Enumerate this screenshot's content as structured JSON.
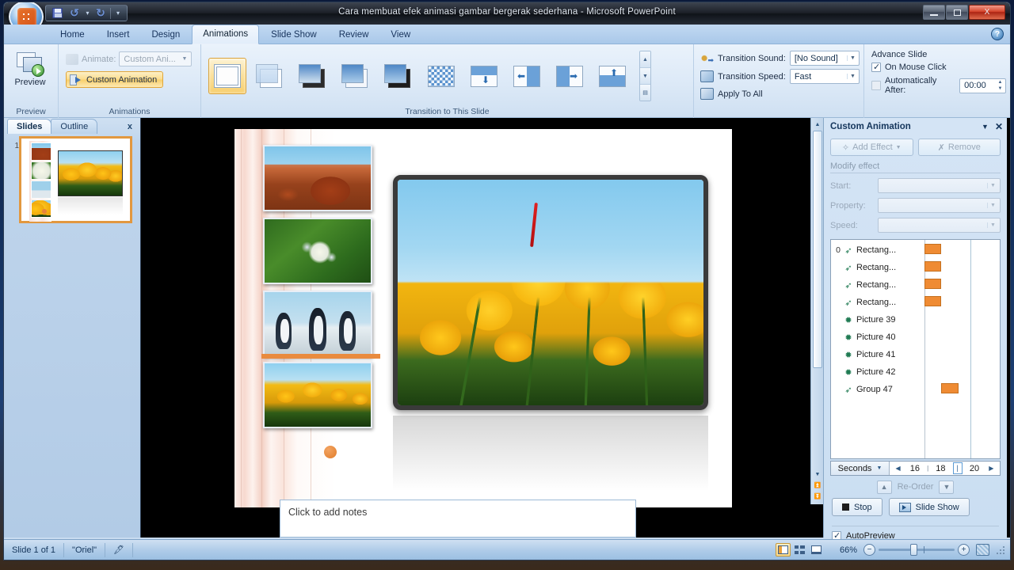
{
  "window": {
    "title": "Cara membuat efek animasi gambar bergerak sederhana  -  Microsoft PowerPoint",
    "minimize_label": "Minimize",
    "maximize_label": "Restore",
    "close_label": "X"
  },
  "quick_access": {
    "save": "save-icon",
    "undo": "undo-icon",
    "undo_dropdown": "chevron-down-icon",
    "redo": "redo-icon",
    "customize": "customize-icon"
  },
  "ribbon": {
    "tabs": [
      {
        "label": "Home",
        "active": false
      },
      {
        "label": "Insert",
        "active": false
      },
      {
        "label": "Design",
        "active": false
      },
      {
        "label": "Animations",
        "active": true
      },
      {
        "label": "Slide Show",
        "active": false
      },
      {
        "label": "Review",
        "active": false
      },
      {
        "label": "View",
        "active": false
      }
    ],
    "help_label": "?",
    "groups": {
      "preview": {
        "label": "Preview",
        "button_label": "Preview"
      },
      "animations": {
        "label": "Animations",
        "animate_label": "Animate:",
        "animate_value": "Custom Ani...",
        "custom_animation_label": "Custom Animation"
      },
      "transition": {
        "label": "Transition to This Slide",
        "items": [
          {
            "name": "No Transition",
            "selected": true
          },
          {
            "name": "Fade Smoothly",
            "selected": false
          },
          {
            "name": "Fade Through Black",
            "selected": false
          },
          {
            "name": "Cut",
            "selected": false
          },
          {
            "name": "Cut Through Black",
            "selected": false
          },
          {
            "name": "Dissolve",
            "selected": false
          },
          {
            "name": "Wipe Down",
            "selected": false
          },
          {
            "name": "Wipe Left",
            "selected": false
          },
          {
            "name": "Wipe Right",
            "selected": false
          },
          {
            "name": "Wipe Up",
            "selected": false
          }
        ]
      },
      "transition_options": {
        "sound_label": "Transition Sound:",
        "sound_value": "[No Sound]",
        "speed_label": "Transition Speed:",
        "speed_value": "Fast",
        "apply_to_all_label": "Apply To All"
      },
      "advance_slide": {
        "title": "Advance Slide",
        "on_mouse_click_label": "On Mouse Click",
        "on_mouse_click_checked": true,
        "automatically_after_label": "Automatically After:",
        "automatically_after_checked": false,
        "automatically_after_value": "00:00"
      }
    }
  },
  "left_pane": {
    "tabs": [
      {
        "label": "Slides",
        "active": true
      },
      {
        "label": "Outline",
        "active": false
      }
    ],
    "close_label": "x",
    "slides": [
      {
        "number": "1",
        "selected": true
      }
    ]
  },
  "notes": {
    "placeholder": "Click to add notes"
  },
  "task_pane": {
    "title": "Custom Animation",
    "caret": "▼",
    "close": "✕",
    "add_effect_label": "Add Effect",
    "remove_label": "Remove",
    "modify_effect_label": "Modify effect",
    "fields": [
      {
        "label": "Start:",
        "value": ""
      },
      {
        "label": "Property:",
        "value": ""
      },
      {
        "label": "Speed:",
        "value": ""
      }
    ],
    "animation_items": [
      {
        "index": "0",
        "icon": "motion-path-icon",
        "name": "Rectang...",
        "bar": true
      },
      {
        "index": "",
        "icon": "motion-path-icon",
        "name": "Rectang...",
        "bar": true
      },
      {
        "index": "",
        "icon": "motion-path-icon",
        "name": "Rectang...",
        "bar": true
      },
      {
        "index": "",
        "icon": "motion-path-icon",
        "name": "Rectang...",
        "bar": true
      },
      {
        "index": "",
        "icon": "star-burst-icon",
        "name": "Picture 39",
        "bar": false
      },
      {
        "index": "",
        "icon": "star-burst-icon",
        "name": "Picture 40",
        "bar": false
      },
      {
        "index": "",
        "icon": "star-burst-icon",
        "name": "Picture 41",
        "bar": false
      },
      {
        "index": "",
        "icon": "star-burst-icon",
        "name": "Picture 42",
        "bar": false
      },
      {
        "index": "",
        "icon": "motion-path-icon",
        "name": "Group 47",
        "bar": true
      }
    ],
    "timeline": {
      "unit_label": "Seconds",
      "prev_arrow": "◀",
      "next_arrow": "▶",
      "ticks": [
        "16",
        "18",
        "20"
      ]
    },
    "reorder_label": "Re-Order",
    "reorder_up": "▲",
    "reorder_down": "▼",
    "stop_label": "Stop",
    "slide_show_label": "Slide Show",
    "autopreview_label": "AutoPreview",
    "autopreview_checked": true
  },
  "status_bar": {
    "slide_count": "Slide 1 of 1",
    "theme": "\"Oriel\"",
    "spellcheck_icon": "spellcheck-icon",
    "views": [
      {
        "name": "normal-view",
        "active": true
      },
      {
        "name": "slide-sorter-view",
        "active": false
      },
      {
        "name": "slide-show-view",
        "active": false
      }
    ],
    "zoom_percent": "66%",
    "zoom_out": "−",
    "zoom_in": "+",
    "fit_to_window": "fit-to-window-icon"
  }
}
